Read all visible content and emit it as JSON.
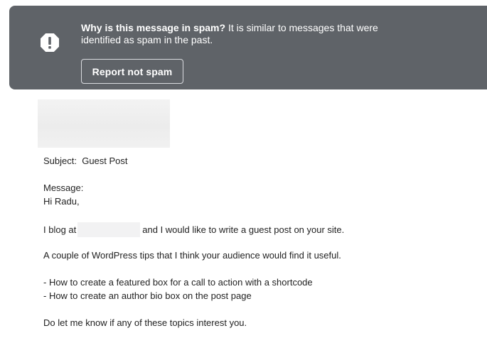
{
  "spam_banner": {
    "heading": "Why is this message in spam?",
    "explanation": "It is similar to messages that were identified as spam in the past.",
    "report_button_label": "Report not spam",
    "help_glyph": "?",
    "icons": {
      "warning": "exclamation-circle-icon",
      "help": "help-icon"
    }
  },
  "email": {
    "subject_label": "Subject:",
    "subject_value": "Guest Post",
    "message_label": "Message:",
    "greeting": "Hi Radu,",
    "blog_intro_before": "I blog at",
    "blog_intro_after": "and I would like to write a guest post on your site.",
    "tips_intro": "A couple of WordPress tips that I think your audience would find it useful.",
    "topics": [
      "- How to create a featured box for a call to action with a shortcode",
      "- How to create an author bio box on the post page"
    ],
    "closing": "Do let me know if any of these topics interest you."
  },
  "colors": {
    "banner_bg": "#5f6368",
    "banner_text": "#ffffff",
    "body_text": "#222222"
  }
}
